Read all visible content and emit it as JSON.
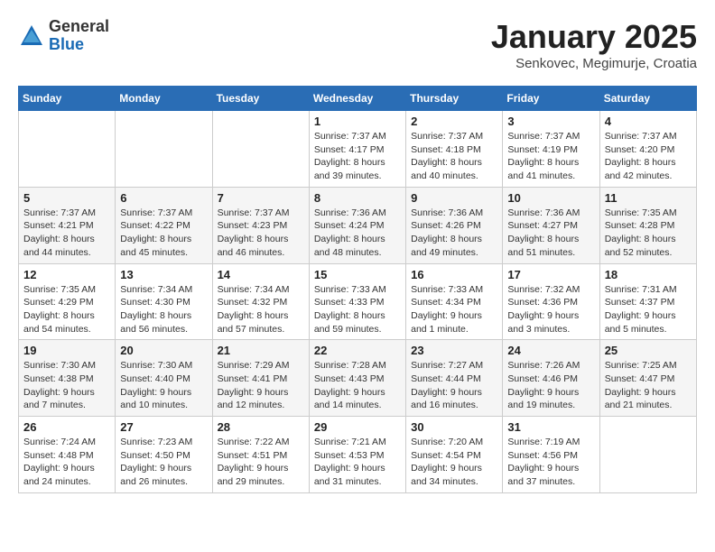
{
  "logo": {
    "general": "General",
    "blue": "Blue"
  },
  "title": "January 2025",
  "subtitle": "Senkovec, Megimurje, Croatia",
  "days_of_week": [
    "Sunday",
    "Monday",
    "Tuesday",
    "Wednesday",
    "Thursday",
    "Friday",
    "Saturday"
  ],
  "weeks": [
    [
      {
        "day": "",
        "info": ""
      },
      {
        "day": "",
        "info": ""
      },
      {
        "day": "",
        "info": ""
      },
      {
        "day": "1",
        "info": "Sunrise: 7:37 AM\nSunset: 4:17 PM\nDaylight: 8 hours and 39 minutes."
      },
      {
        "day": "2",
        "info": "Sunrise: 7:37 AM\nSunset: 4:18 PM\nDaylight: 8 hours and 40 minutes."
      },
      {
        "day": "3",
        "info": "Sunrise: 7:37 AM\nSunset: 4:19 PM\nDaylight: 8 hours and 41 minutes."
      },
      {
        "day": "4",
        "info": "Sunrise: 7:37 AM\nSunset: 4:20 PM\nDaylight: 8 hours and 42 minutes."
      }
    ],
    [
      {
        "day": "5",
        "info": "Sunrise: 7:37 AM\nSunset: 4:21 PM\nDaylight: 8 hours and 44 minutes."
      },
      {
        "day": "6",
        "info": "Sunrise: 7:37 AM\nSunset: 4:22 PM\nDaylight: 8 hours and 45 minutes."
      },
      {
        "day": "7",
        "info": "Sunrise: 7:37 AM\nSunset: 4:23 PM\nDaylight: 8 hours and 46 minutes."
      },
      {
        "day": "8",
        "info": "Sunrise: 7:36 AM\nSunset: 4:24 PM\nDaylight: 8 hours and 48 minutes."
      },
      {
        "day": "9",
        "info": "Sunrise: 7:36 AM\nSunset: 4:26 PM\nDaylight: 8 hours and 49 minutes."
      },
      {
        "day": "10",
        "info": "Sunrise: 7:36 AM\nSunset: 4:27 PM\nDaylight: 8 hours and 51 minutes."
      },
      {
        "day": "11",
        "info": "Sunrise: 7:35 AM\nSunset: 4:28 PM\nDaylight: 8 hours and 52 minutes."
      }
    ],
    [
      {
        "day": "12",
        "info": "Sunrise: 7:35 AM\nSunset: 4:29 PM\nDaylight: 8 hours and 54 minutes."
      },
      {
        "day": "13",
        "info": "Sunrise: 7:34 AM\nSunset: 4:30 PM\nDaylight: 8 hours and 56 minutes."
      },
      {
        "day": "14",
        "info": "Sunrise: 7:34 AM\nSunset: 4:32 PM\nDaylight: 8 hours and 57 minutes."
      },
      {
        "day": "15",
        "info": "Sunrise: 7:33 AM\nSunset: 4:33 PM\nDaylight: 8 hours and 59 minutes."
      },
      {
        "day": "16",
        "info": "Sunrise: 7:33 AM\nSunset: 4:34 PM\nDaylight: 9 hours and 1 minute."
      },
      {
        "day": "17",
        "info": "Sunrise: 7:32 AM\nSunset: 4:36 PM\nDaylight: 9 hours and 3 minutes."
      },
      {
        "day": "18",
        "info": "Sunrise: 7:31 AM\nSunset: 4:37 PM\nDaylight: 9 hours and 5 minutes."
      }
    ],
    [
      {
        "day": "19",
        "info": "Sunrise: 7:30 AM\nSunset: 4:38 PM\nDaylight: 9 hours and 7 minutes."
      },
      {
        "day": "20",
        "info": "Sunrise: 7:30 AM\nSunset: 4:40 PM\nDaylight: 9 hours and 10 minutes."
      },
      {
        "day": "21",
        "info": "Sunrise: 7:29 AM\nSunset: 4:41 PM\nDaylight: 9 hours and 12 minutes."
      },
      {
        "day": "22",
        "info": "Sunrise: 7:28 AM\nSunset: 4:43 PM\nDaylight: 9 hours and 14 minutes."
      },
      {
        "day": "23",
        "info": "Sunrise: 7:27 AM\nSunset: 4:44 PM\nDaylight: 9 hours and 16 minutes."
      },
      {
        "day": "24",
        "info": "Sunrise: 7:26 AM\nSunset: 4:46 PM\nDaylight: 9 hours and 19 minutes."
      },
      {
        "day": "25",
        "info": "Sunrise: 7:25 AM\nSunset: 4:47 PM\nDaylight: 9 hours and 21 minutes."
      }
    ],
    [
      {
        "day": "26",
        "info": "Sunrise: 7:24 AM\nSunset: 4:48 PM\nDaylight: 9 hours and 24 minutes."
      },
      {
        "day": "27",
        "info": "Sunrise: 7:23 AM\nSunset: 4:50 PM\nDaylight: 9 hours and 26 minutes."
      },
      {
        "day": "28",
        "info": "Sunrise: 7:22 AM\nSunset: 4:51 PM\nDaylight: 9 hours and 29 minutes."
      },
      {
        "day": "29",
        "info": "Sunrise: 7:21 AM\nSunset: 4:53 PM\nDaylight: 9 hours and 31 minutes."
      },
      {
        "day": "30",
        "info": "Sunrise: 7:20 AM\nSunset: 4:54 PM\nDaylight: 9 hours and 34 minutes."
      },
      {
        "day": "31",
        "info": "Sunrise: 7:19 AM\nSunset: 4:56 PM\nDaylight: 9 hours and 37 minutes."
      },
      {
        "day": "",
        "info": ""
      }
    ]
  ]
}
